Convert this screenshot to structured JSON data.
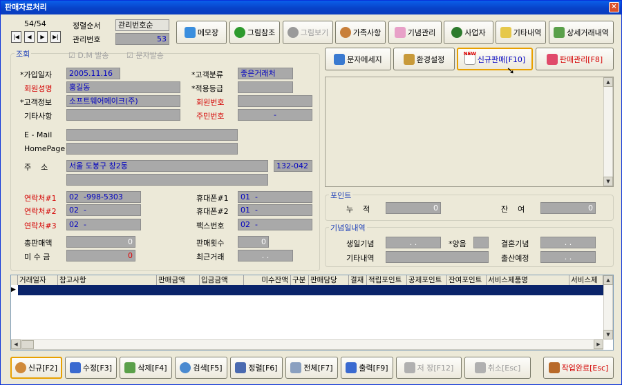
{
  "window": {
    "title": "판매자료처리",
    "close": "×"
  },
  "nav": {
    "counter": "54/54",
    "first": "|◀",
    "prev": "◀",
    "next": "▶",
    "last": "▶|"
  },
  "sort": {
    "label": "정렬순서",
    "value": "관리번호순",
    "mgmt_label": "관리번호",
    "mgmt_value": "53"
  },
  "toolbar": {
    "memo": "메모장",
    "picture_ref": "그림참조",
    "picture_view": "그림보기",
    "family": "가족사항",
    "anniversary": "기념관리",
    "business": "사업자",
    "other_history": "기타내역",
    "detail_trade": "상세거래내역"
  },
  "actions": {
    "sms": "문자메세지",
    "settings": "환경설정",
    "new_sale": "신규판매[F10]",
    "sale_mgmt": "판매관리[F8]",
    "new_badge": "NEW"
  },
  "inquiry": {
    "title": "조회",
    "dm": "D.M 발송",
    "sms_send": "문자발송",
    "join_date_label": "*가입일자",
    "join_date": "2005.11.16",
    "cust_type_label": "*고객분류",
    "cust_type": "좋은거래처",
    "member_name_label": "회원성명",
    "member_name": "홍길동",
    "grade_label": "*적용등급",
    "grade": "",
    "cust_info_label": "*고객정보",
    "cust_info": "소프트웨어메이크(주)",
    "member_no_label": "회원번호",
    "member_no": "",
    "other_label": "기타사항",
    "other": "",
    "resident_label": "주민번호",
    "resident": "-",
    "email_label": "E - Mail",
    "email": "",
    "homepage_label": "HomePage",
    "homepage": "",
    "address_label": "주    소",
    "address": "서울 도봉구 창2동",
    "zip": "132-042",
    "address2": "",
    "contact1_label": "연락처#1",
    "contact1": "02  -998-5303",
    "mobile1_label": "휴대폰#1",
    "mobile1": "01  -",
    "contact2_label": "연락처#2",
    "contact2": "02  -",
    "mobile2_label": "휴대폰#2",
    "mobile2": "01  -",
    "contact3_label": "연락처#3",
    "contact3": "02  -",
    "fax_label": "팩스번호",
    "fax": "02  -",
    "total_sales_label": "총판매액",
    "total_sales": "0",
    "sale_count_label": "판매횟수",
    "sale_count": "0",
    "unpaid_label": "미 수 금",
    "unpaid": "0",
    "recent_label": "최근거래",
    "recent": ". ."
  },
  "points": {
    "title": "포인트",
    "accum_label": "누    적",
    "accum": "0",
    "balance_label": "잔    여",
    "balance": "0"
  },
  "anniv": {
    "title": "기념일내역",
    "birthday_label": "생일기념",
    "birthday": ". .",
    "lunar_label": "*양음",
    "lunar": "",
    "wedding_label": "결혼기념",
    "wedding": ". .",
    "other_label": "기타내역",
    "other": "",
    "birth_label": "출산예정",
    "birth": ". ."
  },
  "table": {
    "columns": [
      "거래일자",
      "참고사항",
      "판매금액",
      "입금금액",
      "미수잔액",
      "구분",
      "판매담당",
      "결재",
      "적립포인트",
      "공제포인트",
      "잔여포인트",
      "서비스제품명",
      "서비스제"
    ]
  },
  "bottom": {
    "new": "신규[F2]",
    "edit": "수정[F3]",
    "delete": "삭제[F4]",
    "search": "검색[F5]",
    "sort": "정렬[F6]",
    "all": "전체[F7]",
    "print": "출력[F9]",
    "save": "저 장[F12]",
    "cancel": "취소[Esc]",
    "done": "작업완료[Esc]"
  },
  "colors": {
    "titlebar": "#0a4fd8",
    "field": "#a9a9a9",
    "value_blue": "#0000c0",
    "label_red": "#d40000",
    "selection": "#0a246a"
  }
}
